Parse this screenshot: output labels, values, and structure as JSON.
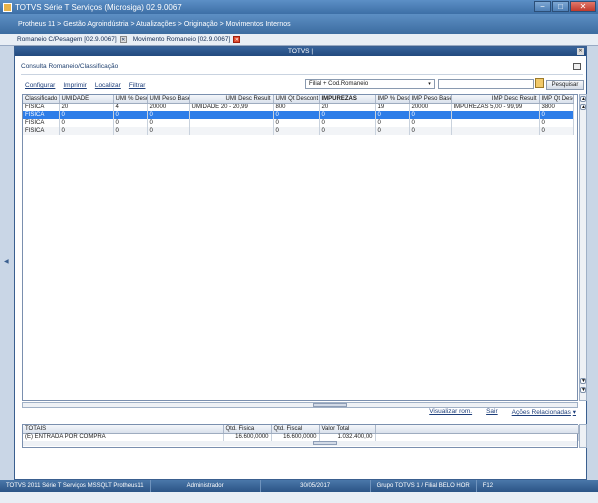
{
  "window": {
    "title": "TOTVS Série T Serviços (Microsiga) 02.9.0067",
    "min_icon": "minimize-icon",
    "max_icon": "maximize-icon",
    "close_icon": "close-icon",
    "min_symbol": "−",
    "max_symbol": "□",
    "close_symbol": "✕"
  },
  "breadcrumb": "Protheus 11 > Gestão Agroindústria > Atualizações > Originação > Movimentos Internos",
  "tabs": [
    {
      "label": "Romaneio C/Pesagem [02.9.0067]",
      "close": "✕"
    },
    {
      "label": "Movimento Romaneio [02.9.0067]",
      "close": "✕"
    }
  ],
  "dialog": {
    "title": "TOTVS |",
    "close": "✕",
    "section_title": "Consulta Romaneio/Classificação",
    "links": [
      "Configurar",
      "Imprimir",
      "Localizar",
      "Filtrar"
    ],
    "filter_value": "Filial + Cod.Romaneio",
    "filter_arrow": "▾",
    "search_value": "",
    "search_button": "Pesquisar"
  },
  "grid": {
    "columns": [
      "Classificado",
      "UMIDADE",
      "UMI % Desc",
      "UMI Peso Base",
      "UMI Desc Result",
      "UMI Qt Descont",
      "IMPUREZAS",
      "IMP % Desc",
      "IMP Peso Base",
      "IMP Desc Result",
      "IMP Qt Desc"
    ],
    "rows": [
      [
        "FISICA",
        "20",
        "4",
        "20000",
        "UMIDADE 20 - 20,99",
        "800",
        "20",
        "19",
        "20000",
        "IMPUREZAS 5,00 - 99,99",
        "3800"
      ],
      [
        "FISICA",
        "0",
        "0",
        "0",
        "",
        "0",
        "0",
        "0",
        "0",
        "",
        "0"
      ],
      [
        "FISICA",
        "0",
        "0",
        "0",
        "",
        "0",
        "0",
        "0",
        "0",
        "",
        "0"
      ],
      [
        "FISICA",
        "0",
        "0",
        "0",
        "",
        "0",
        "0",
        "0",
        "0",
        "",
        "0"
      ]
    ],
    "scroll_up": "▲",
    "scroll_down": "▼"
  },
  "actions": {
    "view": "Visualizar rom.",
    "exit": "Sair",
    "related": "Ações Relacionadas",
    "related_arrow": "▾"
  },
  "totals": {
    "columns": [
      "TOTAIS",
      "Qtd. Fisica",
      "Qtd. Fiscal",
      "Valor Total"
    ],
    "rows": [
      [
        "(E) ENTRADA POR COMPRA",
        "16.600,0000",
        "16.600,0000",
        "1.032.400,00"
      ]
    ]
  },
  "statusbar": [
    "TOTVS 2011 Série T Serviços MSSQLT Protheus11",
    "Administrador",
    "30/05/2017",
    "Grupo TOTVS 1 / Filial BELO HOR",
    "F12"
  ],
  "colors": {
    "selection": "#2d7de8",
    "titlebar": "#3d6fa6",
    "link": "#1d3e7a"
  }
}
